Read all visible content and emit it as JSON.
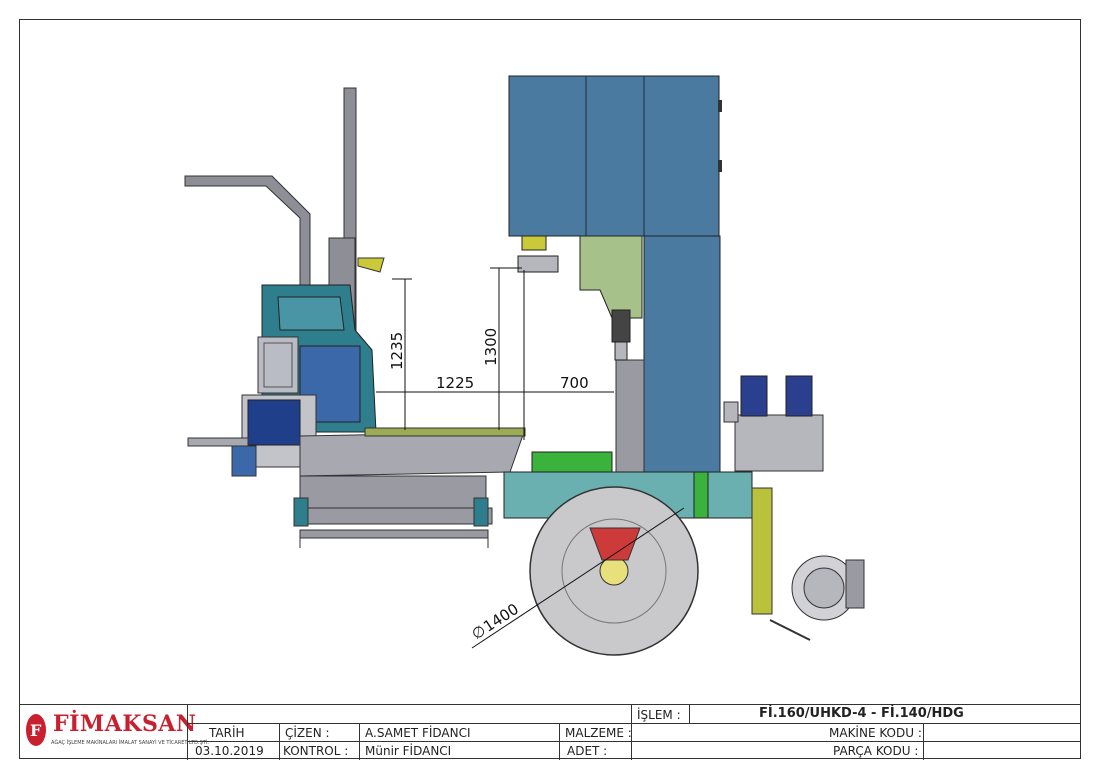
{
  "dimensions": {
    "height_1235": "1235",
    "height_1300": "1300",
    "width_1225": "1225",
    "width_700": "700",
    "wheel_diameter": "1400"
  },
  "title_block": {
    "logo_text": "FİMAKSAN",
    "logo_subtitle": "AĞAÇ İŞLEME MAKİNALARI İMALAT SANAYİ VE TİCARET LTD.ŞTİ.",
    "date_label": "TARİH",
    "date_value": "03.10.2019",
    "drawn_label": "ÇİZEN   :",
    "drawn_value": "A.SAMET FİDANCI",
    "checked_label": "KONTROL  :",
    "checked_value": "Münir FİDANCI",
    "material_label": "MALZEME :",
    "quantity_label": "ADET  :",
    "process_label": "İŞLEM  :",
    "process_value": "Fİ.160/UHKD-4 - Fİ.140/HDG",
    "machine_code_label": "MAKİNE KODU :",
    "part_code_label": "PARÇA KODU :"
  },
  "colors": {
    "cabinet_blue": "#4a7aa0",
    "teal": "#2f7e8e",
    "carriage_gray": "#9a9aa2",
    "green": "#3bb23b",
    "olive_yellow": "#b9c23a",
    "wheel_gray": "#c9c9cc",
    "logo_red": "#c8202f"
  }
}
